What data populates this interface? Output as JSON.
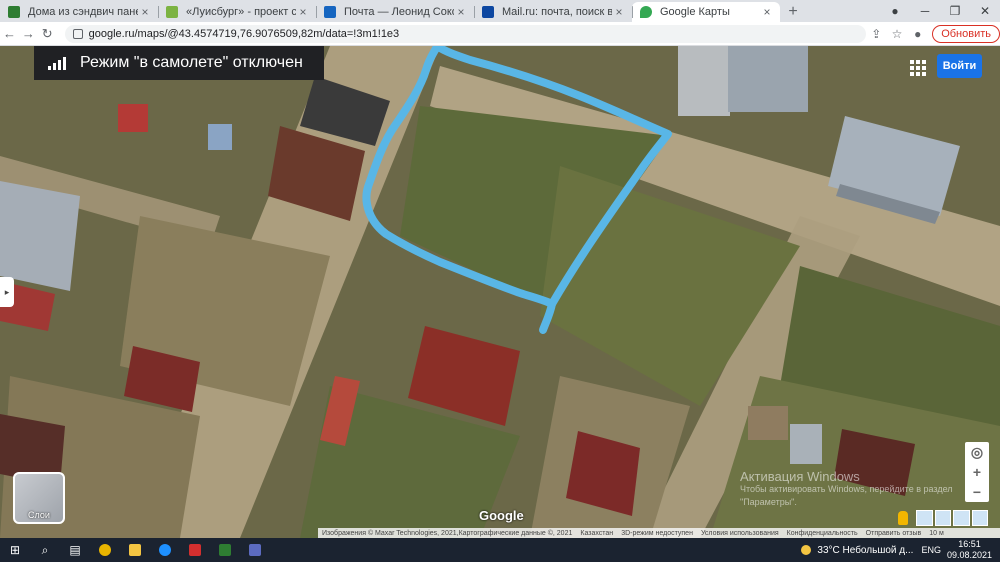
{
  "browser": {
    "tabs": [
      {
        "title": "Дома из сэндвич панелей по к",
        "fav": "#2e7d32",
        "active": false
      },
      {
        "title": "«Луисбург» - проект строитель",
        "fav": "#7cb342",
        "active": false
      },
      {
        "title": "Почта — Леонид Соколов — Ог",
        "fav": "#1565c0",
        "active": false
      },
      {
        "title": "Mail.ru: почта, поиск в интерне",
        "fav": "#0d47a1",
        "active": false
      },
      {
        "title": "Google Карты",
        "fav": "#34a853",
        "active": true
      }
    ],
    "new_tab": "+",
    "close_glyph": "×",
    "window": {
      "download": "●",
      "minimize": "─",
      "restore": "❐",
      "close": "✕"
    },
    "url": "google.ru/maps/@43.4574719,76.9076509,82m/data=!3m1!1e3",
    "update_label": "Обновить",
    "nav": {
      "back": "←",
      "forward": "→",
      "reload": "↻"
    },
    "right_icons": {
      "share": "⇪",
      "star": "☆",
      "profile": "●"
    }
  },
  "map": {
    "toast": "Режим \"в самолете\" отключен",
    "signin_label": "Войти",
    "layers_label": "Слои",
    "logo": "Google",
    "side_arrow": "▸",
    "controls": {
      "locate": "◎",
      "zoom_in": "+",
      "zoom_out": "−"
    },
    "activation": {
      "heading": "Активация Windows",
      "sub1": "Чтобы активировать Windows, перейдите в раздел",
      "sub2": "\"Параметры\"."
    },
    "attribution": [
      "Изображения © Maxar Technologies, 2021,Картографические данные ©, 2021",
      "Казахстан",
      "3D-режим недоступен",
      "Условия использования",
      "Конфиденциальность",
      "Отправить отзыв",
      "10 м"
    ]
  },
  "taskbar": {
    "apps": [
      {
        "name": "windows-start",
        "glyph": "⊞",
        "color": ""
      },
      {
        "name": "search",
        "glyph": "⌕",
        "color": ""
      },
      {
        "name": "task-view",
        "glyph": "▤",
        "color": ""
      },
      {
        "name": "chrome",
        "glyph": "",
        "color": "#e8b400"
      },
      {
        "name": "explorer",
        "glyph": "",
        "color": "#f4c542"
      },
      {
        "name": "edge",
        "glyph": "",
        "color": "#1e90ff"
      },
      {
        "name": "acrobat",
        "glyph": "",
        "color": "#d32f2f"
      },
      {
        "name": "excel",
        "glyph": "",
        "color": "#2e7d32"
      },
      {
        "name": "teams",
        "glyph": "",
        "color": "#5c6bc0"
      }
    ],
    "weather": "33°C  Небольшой д...",
    "lang": "ENG",
    "time": "16:51",
    "date": "09.08.2021"
  }
}
